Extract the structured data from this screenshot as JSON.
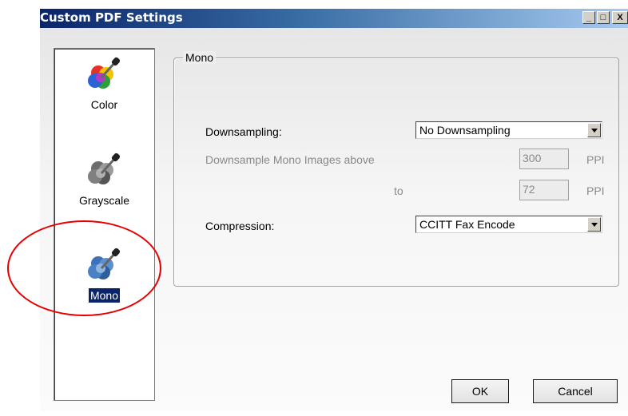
{
  "window": {
    "title": "Custom PDF Settings",
    "controls": {
      "minimize": "_",
      "maximize": "□",
      "close": "X"
    }
  },
  "sidebar": {
    "items": [
      {
        "label": "Color",
        "icon": "color-dropper-icon",
        "selected": false
      },
      {
        "label": "Grayscale",
        "icon": "grayscale-dropper-icon",
        "selected": false
      },
      {
        "label": "Mono",
        "icon": "mono-dropper-icon",
        "selected": true
      }
    ]
  },
  "mono": {
    "group_title": "Mono",
    "downsampling": {
      "label": "Downsampling:",
      "value": "No Downsampling"
    },
    "downsample_above": {
      "label": "Downsample Mono Images above",
      "value": "300",
      "unit": "PPI"
    },
    "downsample_to": {
      "label": "to",
      "value": "72",
      "unit": "PPI"
    },
    "compression": {
      "label": "Compression:",
      "value": "CCITT Fax Encode"
    }
  },
  "buttons": {
    "ok": "OK",
    "cancel": "Cancel"
  },
  "colors": {
    "highlight_oval": "#e60000",
    "title_bar": "#0a246a",
    "selection": "#0a246a"
  }
}
